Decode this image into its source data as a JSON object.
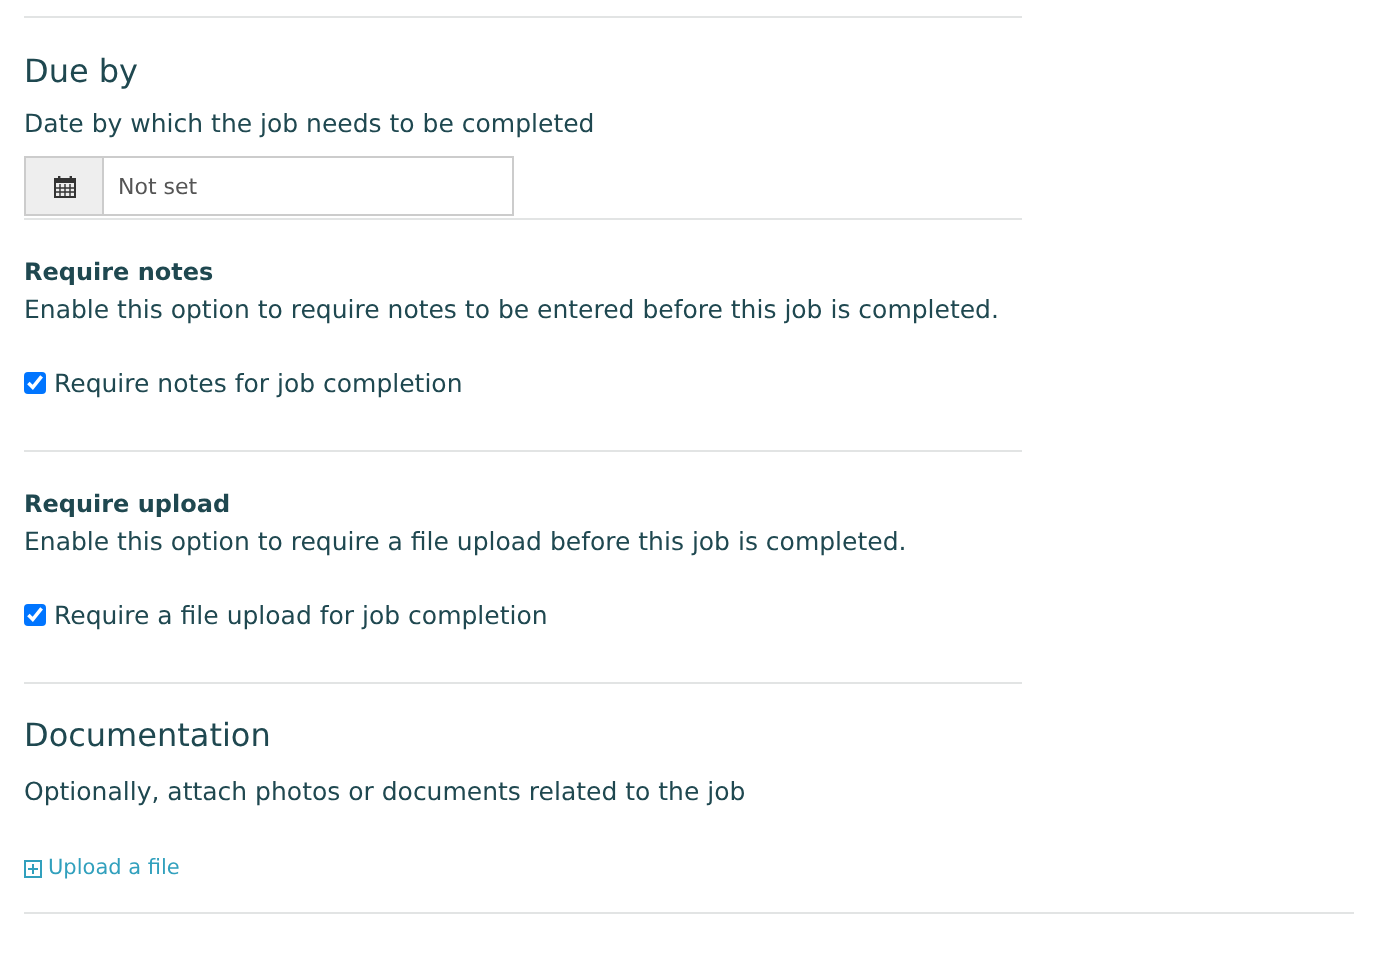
{
  "sections": [
    {
      "kind": "date",
      "title": "Due by",
      "description": "Date by which the job needs to be completed",
      "field": {
        "placeholder": "Not set"
      }
    },
    {
      "kind": "checkbox",
      "title": "Require notes",
      "description": "Enable this option to require notes to be entered before this job is completed.",
      "option": {
        "label": "Require notes for job completion",
        "checked": true
      }
    },
    {
      "kind": "checkbox",
      "title": "Require upload",
      "description": "Enable this option to require a file upload before this job is completed.",
      "option": {
        "label": "Require a file upload for job completion",
        "checked": true
      }
    },
    {
      "kind": "upload",
      "title": "Documentation",
      "description": "Optionally, attach photos or documents related to the job",
      "link": "Upload a file"
    }
  ]
}
